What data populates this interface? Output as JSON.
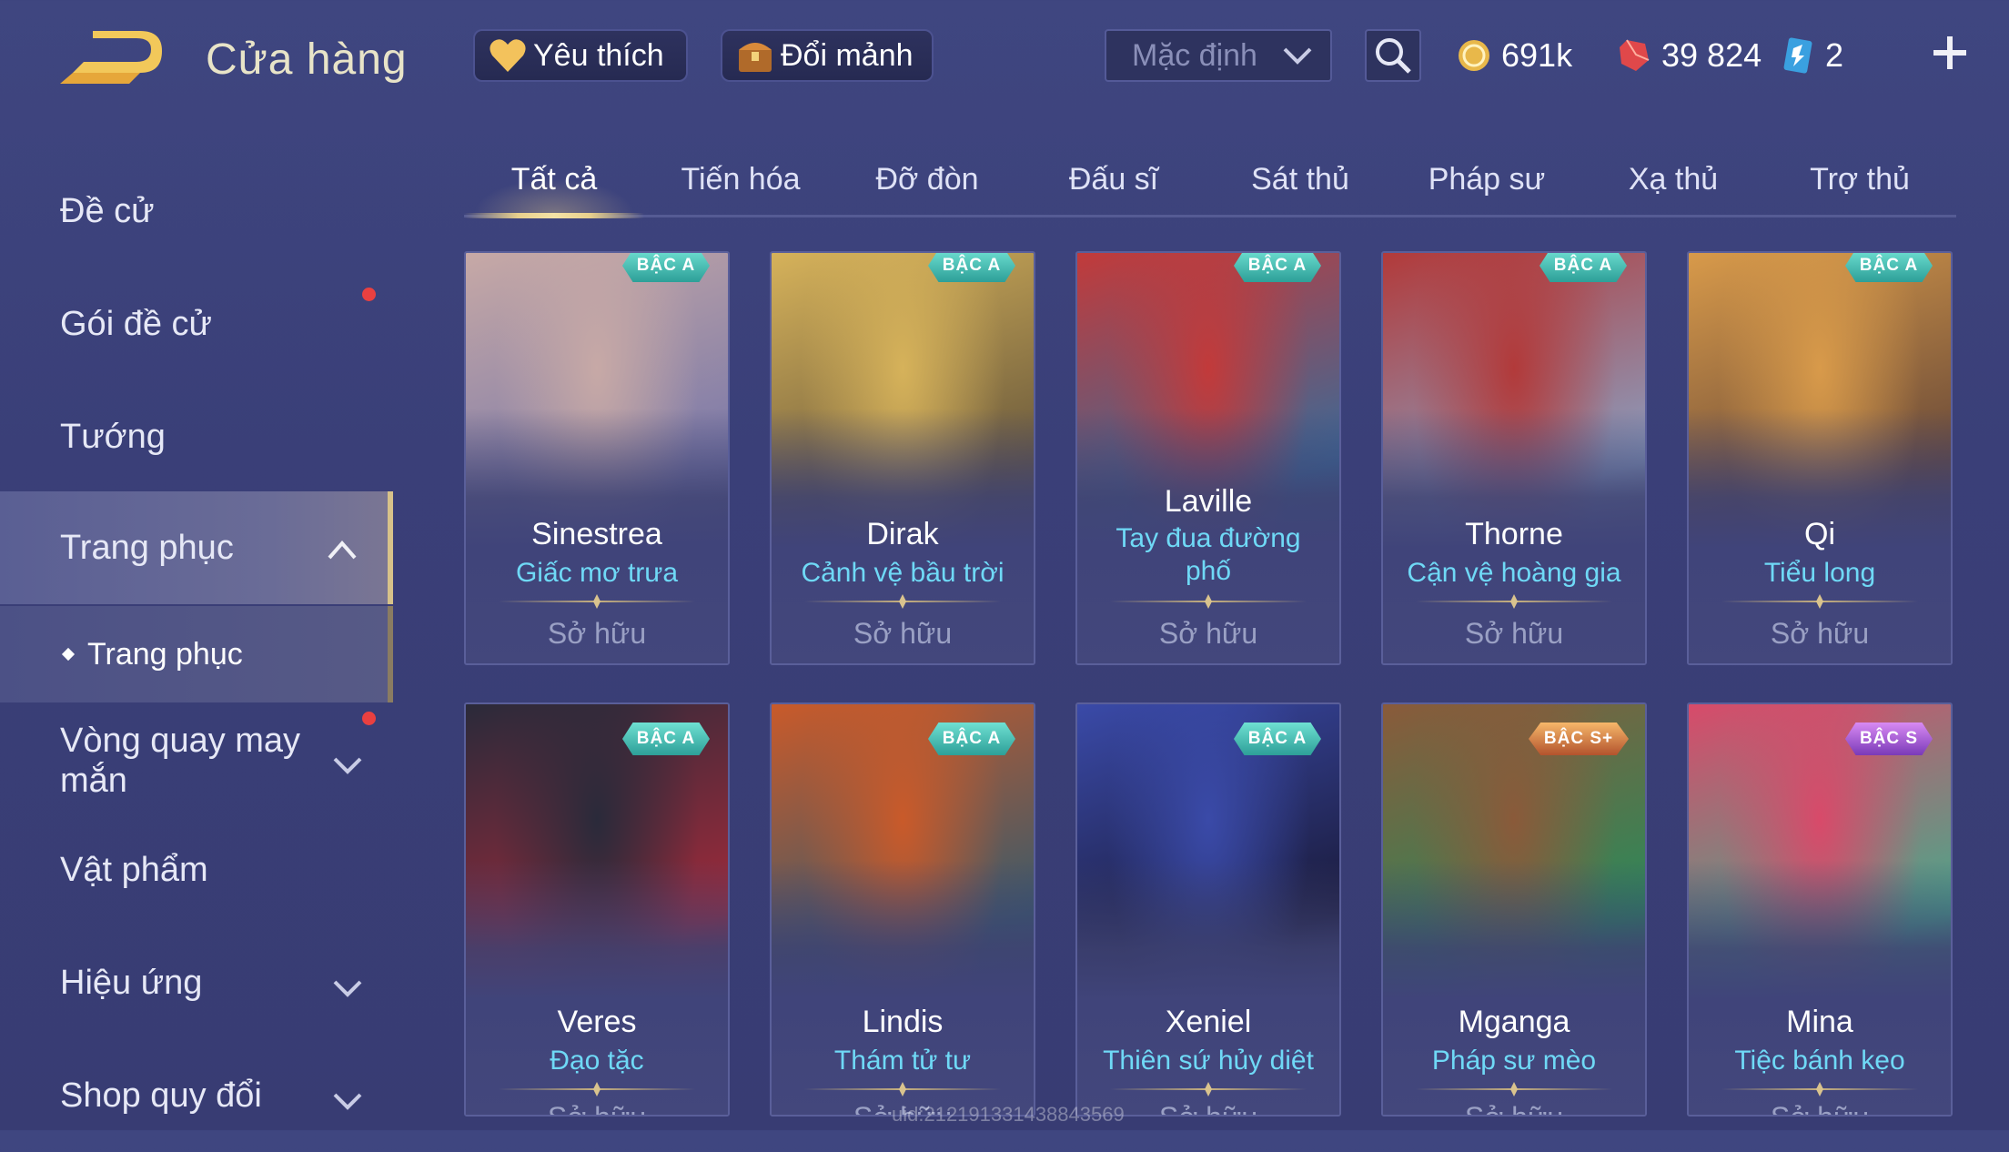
{
  "header": {
    "title": "Cửa hàng",
    "favorite_label": "Yêu thích",
    "fragment_label": "Đổi mảnh",
    "sort_selected": "Mặc định",
    "gold": "691k",
    "gems": "39 824",
    "cards": "2"
  },
  "sidebar": {
    "items": [
      {
        "label": "Đề cử"
      },
      {
        "label": "Gói đề cử"
      },
      {
        "label": "Tướng"
      },
      {
        "label": "Trang phục"
      },
      {
        "label": "Trang phục"
      },
      {
        "label": "Vòng quay may mắn"
      },
      {
        "label": "Vật phẩm"
      },
      {
        "label": "Hiệu ứng"
      },
      {
        "label": "Shop quy đổi"
      }
    ]
  },
  "tabs": [
    "Tất cả",
    "Tiến hóa",
    "Đỡ đòn",
    "Đấu sĩ",
    "Sát thủ",
    "Pháp sư",
    "Xạ thủ",
    "Trợ thủ"
  ],
  "cards": [
    {
      "hero": "Sinestrea",
      "skin": "Giấc mơ trưa",
      "tier": "BẬC A",
      "status": "Sở hữu",
      "colors": [
        "#c7a9a6",
        "#7a78a8"
      ]
    },
    {
      "hero": "Dirak",
      "skin": "Cảnh vệ bầu trời",
      "tier": "BẬC A",
      "status": "Sở hữu",
      "colors": [
        "#d6b25a",
        "#6b5a3c"
      ]
    },
    {
      "hero": "Laville",
      "skin": "Tay đua đường phố",
      "tier": "BẬC A",
      "status": "Sở hữu",
      "colors": [
        "#c23a3a",
        "#3a6a98"
      ]
    },
    {
      "hero": "Thorne",
      "skin": "Cận vệ hoàng gia",
      "tier": "BẬC A",
      "status": "Sở hữu",
      "colors": [
        "#b23a3a",
        "#8a9ec0"
      ]
    },
    {
      "hero": "Qi",
      "skin": "Tiểu long",
      "tier": "BẬC A",
      "status": "Sở hữu",
      "colors": [
        "#d89a4a",
        "#6a4a38"
      ]
    },
    {
      "hero": "Veres",
      "skin": "Đạo tặc",
      "tier": "BẬC A",
      "status": "Sở hữu",
      "colors": [
        "#2a2a3a",
        "#a02a3a"
      ]
    },
    {
      "hero": "Lindis",
      "skin": "Thám tử tư",
      "tier": "BẬC A",
      "status": "Sở hữu",
      "colors": [
        "#c95a2a",
        "#3a5a6a"
      ]
    },
    {
      "hero": "Xeniel",
      "skin": "Thiên sứ hủy diệt",
      "tier": "BẬC A",
      "status": "Sở hữu",
      "colors": [
        "#3a4aa8",
        "#1a1a3a"
      ]
    },
    {
      "hero": "Mganga",
      "skin": "Pháp sư mèo",
      "tier": "BẬC S+",
      "status": "Sở hữu",
      "colors": [
        "#8a5a3a",
        "#2a8a5a"
      ]
    },
    {
      "hero": "Mina",
      "skin": "Tiệc bánh kẹo",
      "tier": "BẬC S",
      "status": "Sở hữu",
      "colors": [
        "#d84a6a",
        "#4aa88a"
      ]
    }
  ],
  "watermark": "uid:212191331438843569"
}
